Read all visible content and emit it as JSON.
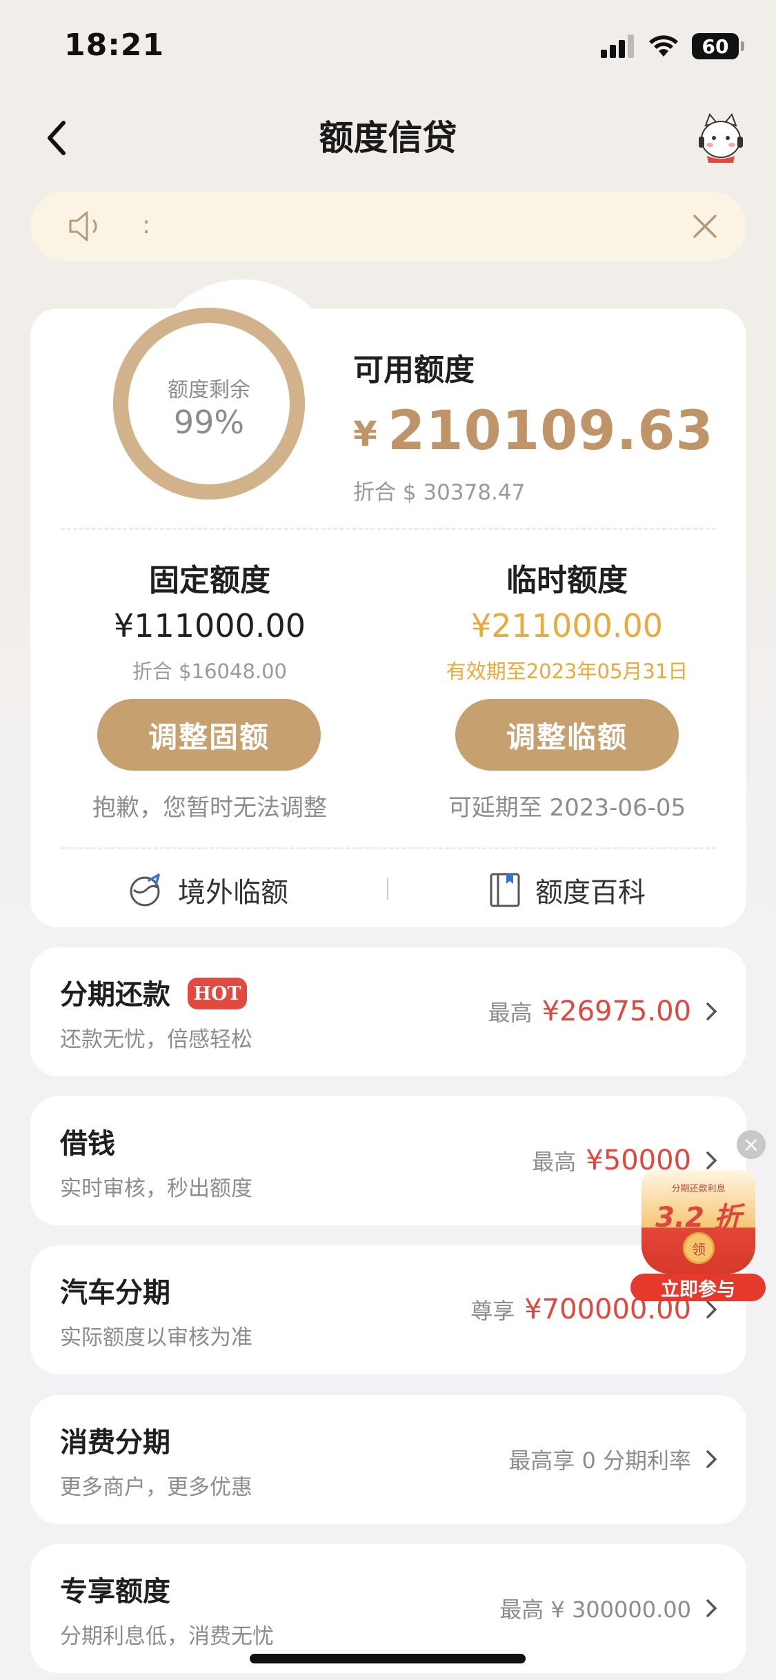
{
  "status_bar": {
    "time": "18:21",
    "battery": "60"
  },
  "nav": {
    "title": "额度信贷"
  },
  "notice": {
    "text": ":"
  },
  "credit": {
    "ring_label": "额度剩余",
    "ring_value": "99%",
    "remaining_fraction": 0.99,
    "available_label": "可用额度",
    "currency_symbol": "¥",
    "available_amount": "210109.63",
    "available_usd": "折合 $ 30378.47"
  },
  "fixed": {
    "title": "固定额度",
    "amount": "¥111000.00",
    "usd": "折合 $16048.00",
    "button": "调整固额",
    "note": "抱歉，您暂时无法调整"
  },
  "temporary": {
    "title": "临时额度",
    "amount": "¥211000.00",
    "valid": "有效期至2023年05月31日",
    "button": "调整临额",
    "note": "可延期至 2023-06-05"
  },
  "links": {
    "overseas": "境外临额",
    "encyclopedia": "额度百科"
  },
  "items": [
    {
      "title": "分期还款",
      "badge": "HOT",
      "sub": "还款无忧，倍感轻松",
      "prefix": "最高",
      "value": "¥26975.00"
    },
    {
      "title": "借钱",
      "sub": "实时审核，秒出额度",
      "prefix": "最高",
      "value": "¥50000"
    },
    {
      "title": "汽车分期",
      "sub": "实际额度以审核为准",
      "prefix": "尊享",
      "value": "¥700000.00"
    },
    {
      "title": "消费分期",
      "sub": "更多商户，更多优惠",
      "value": "最高享 0 分期利率"
    },
    {
      "title": "专享额度",
      "sub": "分期利息低，消费无忧",
      "value": "最高 ¥ 300000.00"
    }
  ],
  "promo": {
    "small": "分期还款利息",
    "big": "3.2 折",
    "coin": "领",
    "button": "立即参与"
  },
  "colors": {
    "gold": "#bf9469",
    "button_gold": "#c6a06f",
    "temp_orange": "#e9a93b",
    "red": "#e1473e"
  }
}
